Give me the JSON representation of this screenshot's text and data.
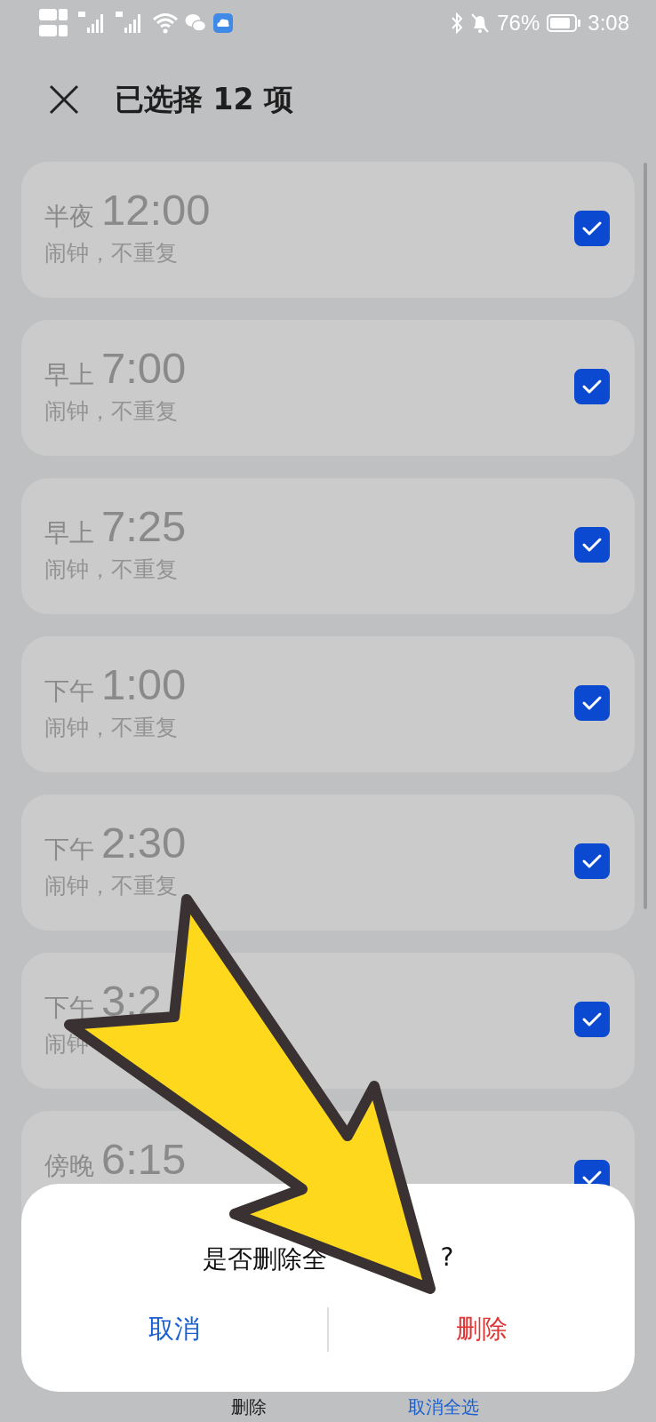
{
  "status_bar": {
    "battery": "76%",
    "time": "3:08"
  },
  "header": {
    "title": "已选择 12 项"
  },
  "alarms": [
    {
      "period": "半夜",
      "time": "12:00",
      "subtitle": "闹钟，不重复",
      "checked": true
    },
    {
      "period": "早上",
      "time": "7:00",
      "subtitle": "闹钟，不重复",
      "checked": true
    },
    {
      "period": "早上",
      "time": "7:25",
      "subtitle": "闹钟，不重复",
      "checked": true
    },
    {
      "period": "下午",
      "time": "1:00",
      "subtitle": "闹钟，不重复",
      "checked": true
    },
    {
      "period": "下午",
      "time": "2:30",
      "subtitle": "闹钟，不重复",
      "checked": true
    },
    {
      "period": "下午",
      "time": "3:2",
      "subtitle": "闹钟",
      "checked": true
    },
    {
      "period": "傍晚",
      "time": "6:15",
      "checked": true
    }
  ],
  "dialog": {
    "message": "是否删除全",
    "message_end": "?",
    "buttons": [
      {
        "label": "取消",
        "kind": "cancel"
      },
      {
        "label": "删除",
        "kind": "confirm"
      }
    ]
  },
  "bottom_bar": [
    {
      "label": "删除",
      "kind": "action"
    },
    {
      "label": "取消全选",
      "kind": "link"
    }
  ]
}
